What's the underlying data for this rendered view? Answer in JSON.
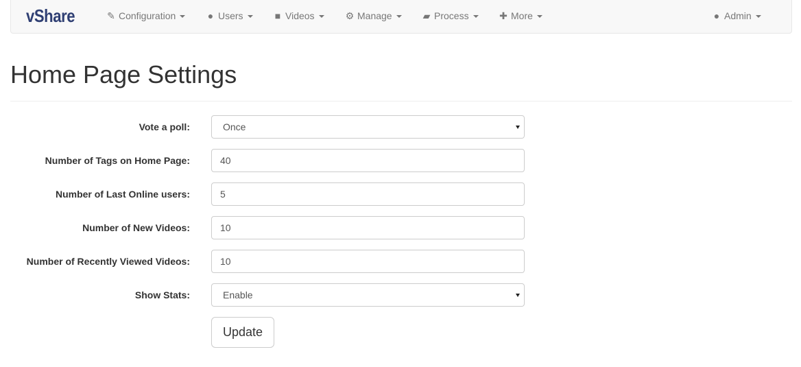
{
  "navbar": {
    "brand": "vShare",
    "items": [
      {
        "label": "Configuration",
        "icon": "wrench-icon",
        "glyph": "🔧"
      },
      {
        "label": "Users",
        "icon": "user-icon",
        "glyph": "👤"
      },
      {
        "label": "Videos",
        "icon": "video-camera-icon",
        "glyph": "■"
      },
      {
        "label": "Manage",
        "icon": "cog-icon",
        "glyph": "⚙"
      },
      {
        "label": "Process",
        "icon": "folder-open-icon",
        "glyph": "📂"
      },
      {
        "label": "More",
        "icon": "plus-icon",
        "glyph": "✚"
      }
    ],
    "admin": {
      "label": "Admin",
      "icon": "user-icon",
      "glyph": "👤"
    }
  },
  "page": {
    "title": "Home Page Settings"
  },
  "form": {
    "vote_poll": {
      "label": "Vote a poll:",
      "value": "Once"
    },
    "num_tags": {
      "label": "Number of Tags on Home Page:",
      "value": "40"
    },
    "last_online": {
      "label": "Number of Last Online users:",
      "value": "5"
    },
    "new_videos": {
      "label": "Number of New Videos:",
      "value": "10"
    },
    "recent_viewed": {
      "label": "Number of Recently Viewed Videos:",
      "value": "10"
    },
    "show_stats": {
      "label": "Show Stats:",
      "value": "Enable"
    },
    "update_label": "Update"
  }
}
